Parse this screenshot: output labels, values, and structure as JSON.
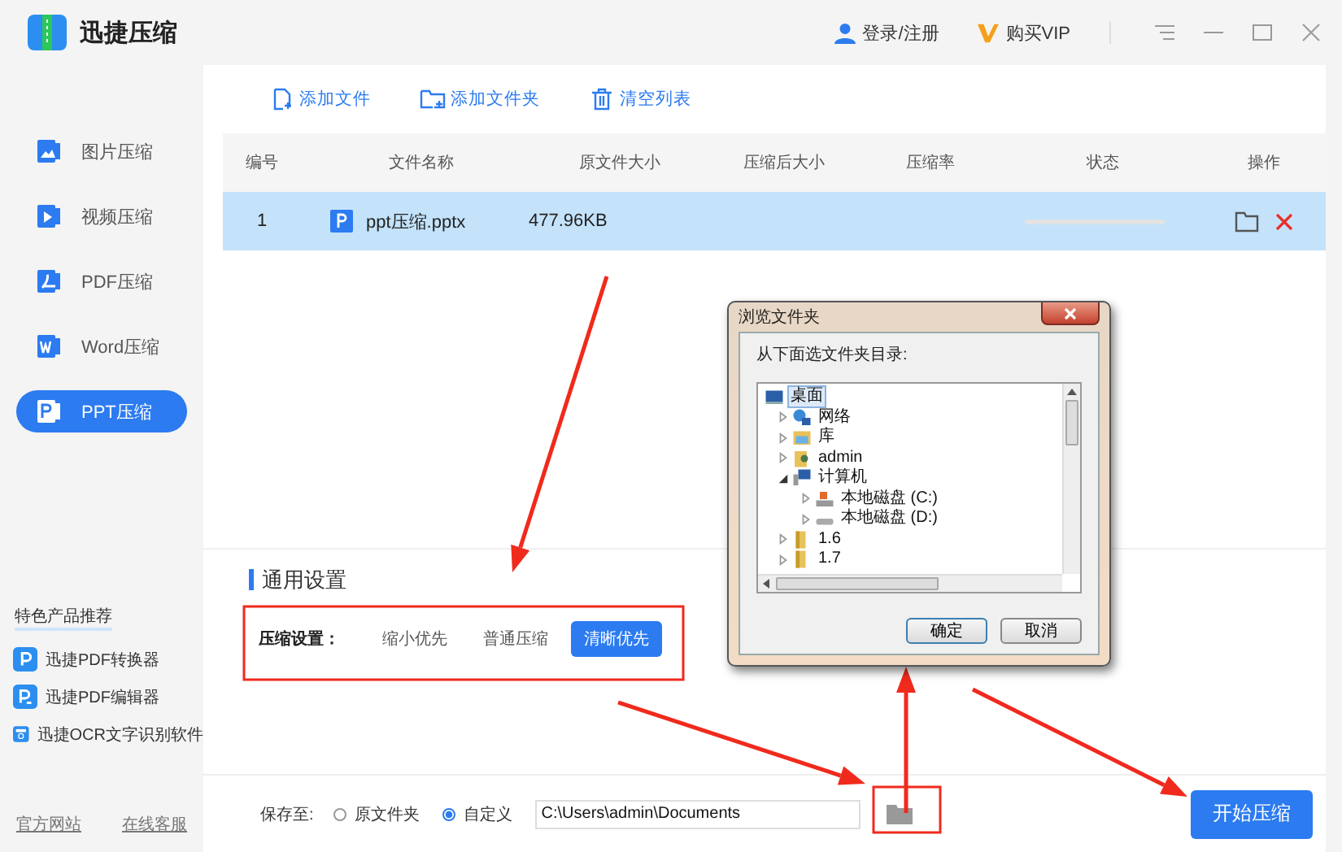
{
  "app": {
    "title": "迅捷压缩"
  },
  "header": {
    "login": "登录/注册",
    "vip": "购买VIP"
  },
  "sidebar": {
    "items": [
      {
        "label": "图片压缩",
        "kind": "image",
        "selected": false
      },
      {
        "label": "视频压缩",
        "kind": "video",
        "selected": false
      },
      {
        "label": "PDF压缩",
        "kind": "pdf",
        "selected": false
      },
      {
        "label": "Word压缩",
        "kind": "word",
        "selected": false
      },
      {
        "label": "PPT压缩",
        "kind": "ppt",
        "selected": true
      }
    ],
    "featured_title": "特色产品推荐",
    "products": [
      {
        "label": "迅捷PDF转换器",
        "kind": "converter"
      },
      {
        "label": "迅捷PDF编辑器",
        "kind": "editor"
      },
      {
        "label": "迅捷OCR文字识别软件",
        "kind": "ocr"
      }
    ],
    "links": [
      "官方网站",
      "在线客服"
    ]
  },
  "toolbar": [
    {
      "label": "添加文件",
      "kind": "add-file"
    },
    {
      "label": "添加文件夹",
      "kind": "add-folder"
    },
    {
      "label": "清空列表",
      "kind": "clear"
    }
  ],
  "table": {
    "columns": [
      "编号",
      "文件名称",
      "原文件大小",
      "压缩后大小",
      "压缩率",
      "状态",
      "操作"
    ],
    "rows": [
      {
        "number": "1",
        "name": "ppt压缩.pptx",
        "original_size": "477.96KB",
        "selected": true
      }
    ]
  },
  "settings": {
    "title": "通用设置",
    "label": "压缩设置：",
    "options": [
      {
        "label": "缩小优先",
        "selected": false
      },
      {
        "label": "普通压缩",
        "selected": false
      },
      {
        "label": "清晰优先",
        "selected": true
      }
    ]
  },
  "save": {
    "label": "保存至:",
    "options": [
      {
        "label": "原文件夹",
        "selected": false
      },
      {
        "label": "自定义",
        "selected": true
      }
    ],
    "path": "C:\\Users\\admin\\Documents"
  },
  "start_button": "开始压缩",
  "dialog": {
    "title": "浏览文件夹",
    "prompt": "从下面选文件夹目录:",
    "tree": [
      {
        "label": "桌面",
        "kind": "desktop",
        "selected": true,
        "expanded": true,
        "children": [
          {
            "label": "网络",
            "kind": "network",
            "selected": false,
            "expanded": false
          },
          {
            "label": "库",
            "kind": "library",
            "selected": false,
            "expanded": false
          },
          {
            "label": "admin",
            "kind": "user",
            "selected": false,
            "expanded": false
          },
          {
            "label": "计算机",
            "kind": "computer",
            "selected": false,
            "expanded": true,
            "children": [
              {
                "label": "本地磁盘 (C:)",
                "kind": "system-drive",
                "selected": false,
                "expanded": false
              },
              {
                "label": "本地磁盘 (D:)",
                "kind": "drive",
                "selected": false,
                "expanded": false
              }
            ]
          },
          {
            "label": "1.6",
            "kind": "folder",
            "selected": false,
            "expanded": false
          },
          {
            "label": "1.7",
            "kind": "folder",
            "selected": false,
            "expanded": false
          }
        ]
      }
    ],
    "buttons": [
      {
        "label": "确定",
        "selected": true
      },
      {
        "label": "取消",
        "selected": false
      }
    ]
  }
}
